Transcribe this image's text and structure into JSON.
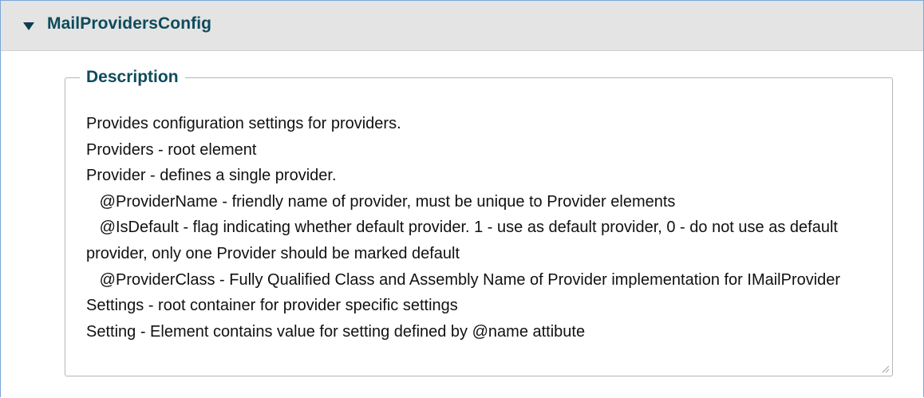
{
  "section": {
    "title": "MailProvidersConfig",
    "expanded": true,
    "toggle_icon": "caret-down-icon"
  },
  "description": {
    "legend": "Description",
    "text": "Provides configuration settings for providers.\nProviders - root element\nProvider - defines a single provider.\n   @ProviderName - friendly name of provider, must be unique to Provider elements\n   @IsDefault - flag indicating whether default provider. 1 - use as default provider, 0 - do not use as default provider, only one Provider should be marked default\n   @ProviderClass - Fully Qualified Class and Assembly Name of Provider implementation for IMailProvider\nSettings - root container for provider specific settings\nSetting - Element contains value for setting defined by @name attibute"
  },
  "colors": {
    "header_bg": "#e4e4e4",
    "title_color": "#0d4b5c",
    "border_accent": "#7aa7d9"
  }
}
